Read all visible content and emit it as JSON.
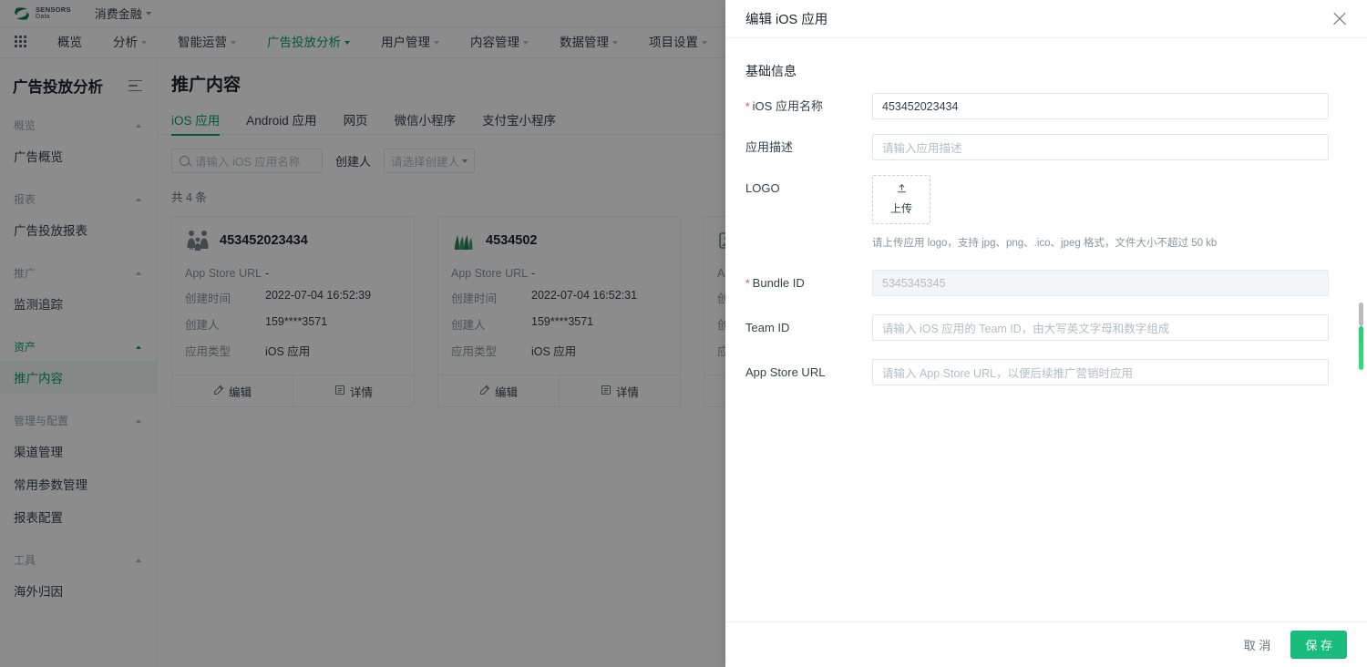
{
  "colors": {
    "accent": "#0aa06e",
    "save_button": "#19bc7d",
    "required": "#e34d59",
    "scroll_green": "#2fe07a"
  },
  "topbar": {
    "brand_title": "SENSORS",
    "brand_sub": "Data",
    "project": "消费金融"
  },
  "nav": {
    "items": [
      {
        "label": "概览",
        "caret": false,
        "active": false
      },
      {
        "label": "分析",
        "caret": true,
        "active": false
      },
      {
        "label": "智能运营",
        "caret": true,
        "active": false
      },
      {
        "label": "广告投放分析",
        "caret": true,
        "active": true
      },
      {
        "label": "用户管理",
        "caret": true,
        "active": false
      },
      {
        "label": "内容管理",
        "caret": true,
        "active": false
      },
      {
        "label": "数据管理",
        "caret": true,
        "active": false
      },
      {
        "label": "项目设置",
        "caret": true,
        "active": false
      }
    ]
  },
  "sidebar": {
    "title": "广告投放分析",
    "groups": [
      {
        "label": "概览",
        "active": false,
        "items": [
          {
            "label": "广告概览",
            "active": false
          }
        ]
      },
      {
        "label": "报表",
        "active": false,
        "items": [
          {
            "label": "广告投放报表",
            "active": false
          }
        ]
      },
      {
        "label": "推广",
        "active": false,
        "items": [
          {
            "label": "监测追踪",
            "active": false
          }
        ]
      },
      {
        "label": "资产",
        "active": true,
        "items": [
          {
            "label": "推广内容",
            "active": true
          }
        ]
      },
      {
        "label": "管理与配置",
        "active": false,
        "items": [
          {
            "label": "渠道管理",
            "active": false
          },
          {
            "label": "常用参数管理",
            "active": false
          },
          {
            "label": "报表配置",
            "active": false
          }
        ]
      },
      {
        "label": "工具",
        "active": false,
        "items": [
          {
            "label": "海外归因",
            "active": false
          }
        ]
      }
    ]
  },
  "main": {
    "page_title": "推广内容",
    "tabs": [
      {
        "label": "iOS 应用",
        "active": true
      },
      {
        "label": "Android 应用",
        "active": false
      },
      {
        "label": "网页",
        "active": false
      },
      {
        "label": "微信小程序",
        "active": false
      },
      {
        "label": "支付宝小程序",
        "active": false
      }
    ],
    "search_placeholder": "请输入 iOS 应用名称",
    "creator_label": "创建人",
    "creator_placeholder": "请选择创建人",
    "total_text": "共 4 条",
    "card_field_labels": {
      "app_store_url": "App Store URL",
      "created_at": "创建时间",
      "creator": "创建人",
      "app_type": "应用类型"
    },
    "card_actions": {
      "edit": "编辑",
      "detail": "详情"
    },
    "cards": [
      {
        "title": "453452023434",
        "icon": "family-icon",
        "app_store_url": "-",
        "created_at": "2022-07-04 16:52:39",
        "creator": "159****3571",
        "app_type": "iOS 应用"
      },
      {
        "title": "4534502",
        "icon": "grass-icon",
        "app_store_url": "-",
        "created_at": "2022-07-04 16:52:31",
        "creator": "159****3571",
        "app_type": "iOS 应用"
      },
      {
        "title": "",
        "icon": "image-icon",
        "app_store_url": "-",
        "created_at": "",
        "creator": "",
        "app_type": ""
      }
    ]
  },
  "drawer": {
    "title": "编辑 iOS 应用",
    "close_icon": "close-icon",
    "section_title": "基础信息",
    "fields": [
      {
        "label": "iOS 应用名称",
        "required": true,
        "value": "453452023434",
        "placeholder": "",
        "disabled": false
      },
      {
        "label": "应用描述",
        "required": false,
        "value": "",
        "placeholder": "请输入应用描述",
        "disabled": false
      },
      {
        "label": "Bundle ID",
        "required": true,
        "value": "",
        "placeholder": "5345345345",
        "disabled": true
      },
      {
        "label": "Team ID",
        "required": false,
        "value": "",
        "placeholder": "请输入 iOS 应用的 Team ID，由大写英文字母和数字组成",
        "disabled": false
      },
      {
        "label": "App Store URL",
        "required": false,
        "value": "",
        "placeholder": "请输入 App Store URL，以便后续推广营销时应用",
        "disabled": false
      }
    ],
    "logo": {
      "label": "LOGO",
      "upload_label": "上传",
      "upload_icon": "upload-icon",
      "hint": "请上传应用 logo，支持 jpg、png、.ico、jpeg 格式，文件大小不超过 50 kb"
    },
    "footer": {
      "cancel": "取 消",
      "save": "保 存"
    }
  }
}
